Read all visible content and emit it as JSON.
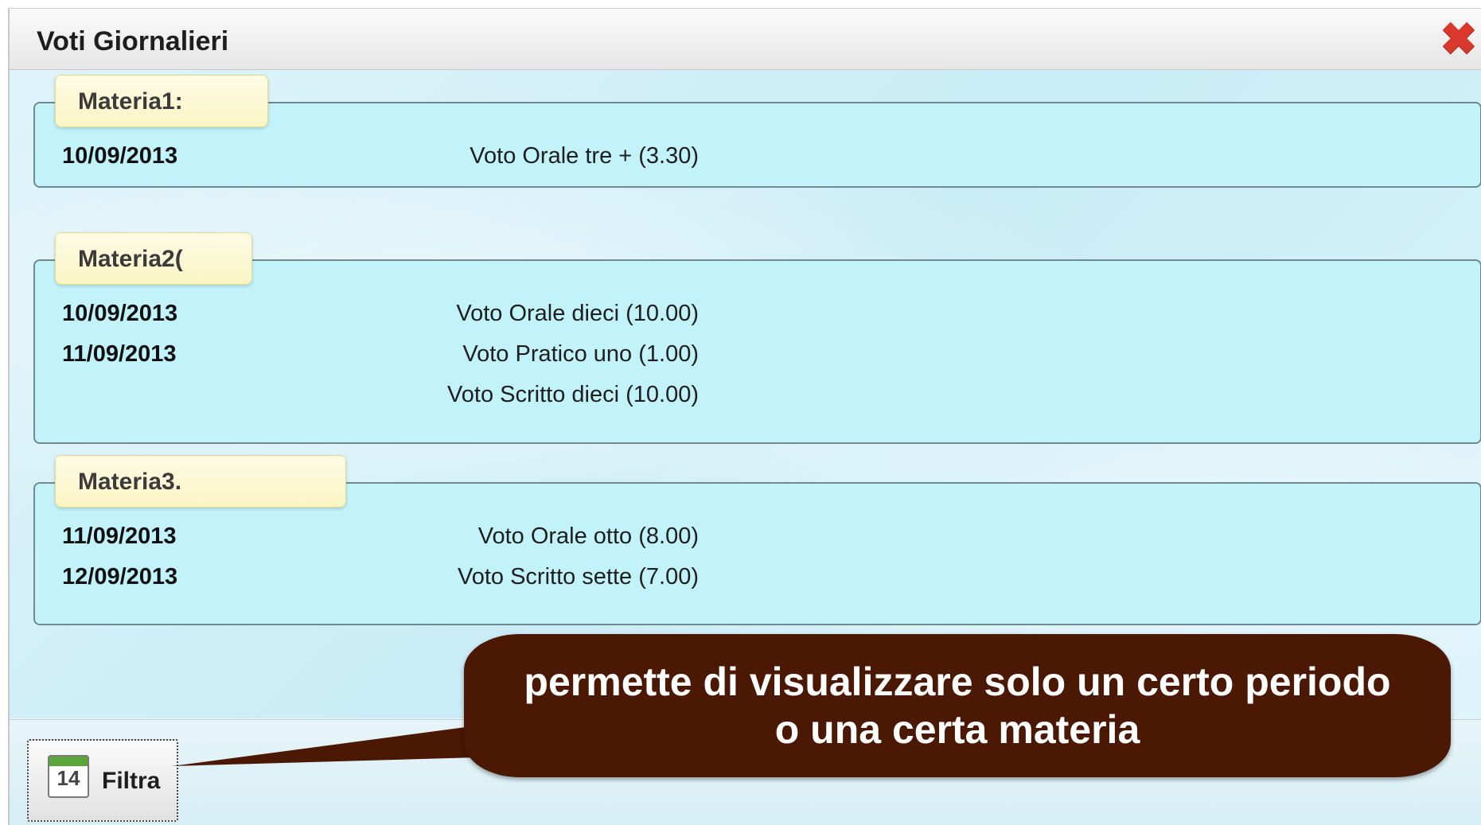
{
  "window": {
    "title": "Voti Giornalieri",
    "close_icon": "close-icon"
  },
  "groups": [
    {
      "subject": "Materia1:",
      "rows": [
        {
          "date": "10/09/2013",
          "grade": "Voto Orale tre + (3.30)"
        }
      ]
    },
    {
      "subject": "Materia2(",
      "rows": [
        {
          "date": "10/09/2013",
          "grade": "Voto Orale dieci (10.00)"
        },
        {
          "date": "11/09/2013",
          "grade": "Voto Pratico uno (1.00)"
        },
        {
          "date": "",
          "grade": "Voto Scritto dieci (10.00)"
        }
      ]
    },
    {
      "subject": "Materia3.",
      "rows": [
        {
          "date": "11/09/2013",
          "grade": "Voto Orale otto (8.00)"
        },
        {
          "date": "12/09/2013",
          "grade": "Voto Scritto sette (7.00)"
        }
      ]
    }
  ],
  "footer": {
    "filter_label": "Filtra",
    "calendar_number": "14",
    "calendar_icon": "calendar-icon"
  },
  "callout": {
    "line1": "permette di visualizzare solo un certo periodo",
    "line2": "o una certa materia"
  },
  "colors": {
    "group_bg": "#c2f3fb",
    "legend_bg": "#fbf5c4",
    "callout_bg": "#4b1804",
    "close": "#d8392c"
  }
}
